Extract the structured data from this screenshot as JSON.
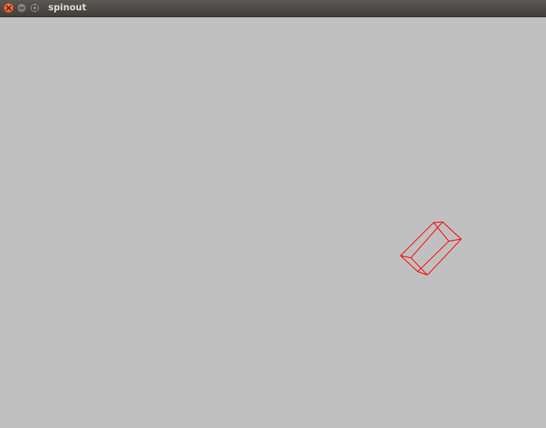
{
  "window": {
    "title": "spinout"
  },
  "titlebar": {
    "buttons": [
      {
        "name": "close",
        "icon": "close-icon"
      },
      {
        "name": "minimize",
        "icon": "minimize-icon"
      },
      {
        "name": "maximize",
        "icon": "maximize-icon"
      }
    ]
  },
  "canvas": {
    "background_color": "#c0c0c0",
    "shape": {
      "kind": "wireframe-box",
      "stroke_color": "#ff0000"
    }
  }
}
